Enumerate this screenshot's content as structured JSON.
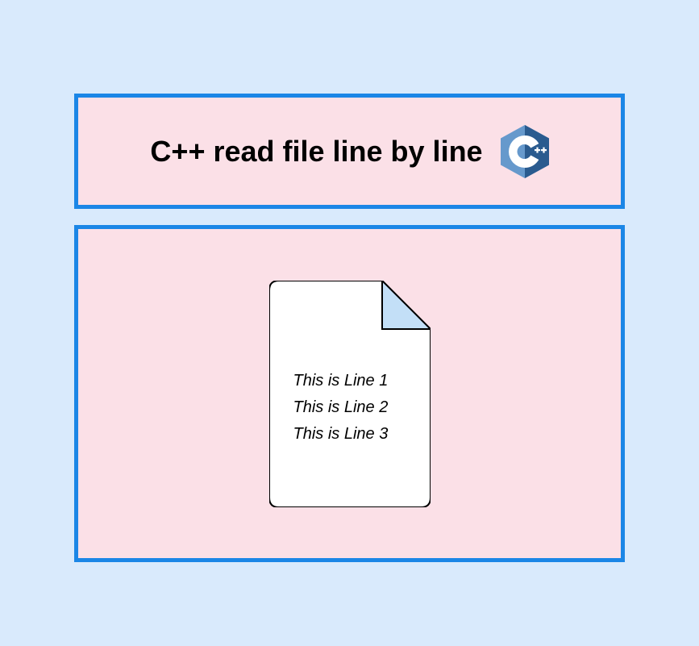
{
  "header": {
    "title": "C++ read file line by line",
    "logo_name": "cpp-logo-icon"
  },
  "file": {
    "lines": [
      "This is Line 1",
      "This is Line 2",
      "This is Line 3"
    ]
  },
  "colors": {
    "page_bg": "#d9eafc",
    "panel_bg": "#fbe0e7",
    "panel_border": "#1b86e6",
    "logo_light": "#6699cc",
    "logo_dark": "#2a5b8f",
    "file_fold": "#c3dff7"
  }
}
